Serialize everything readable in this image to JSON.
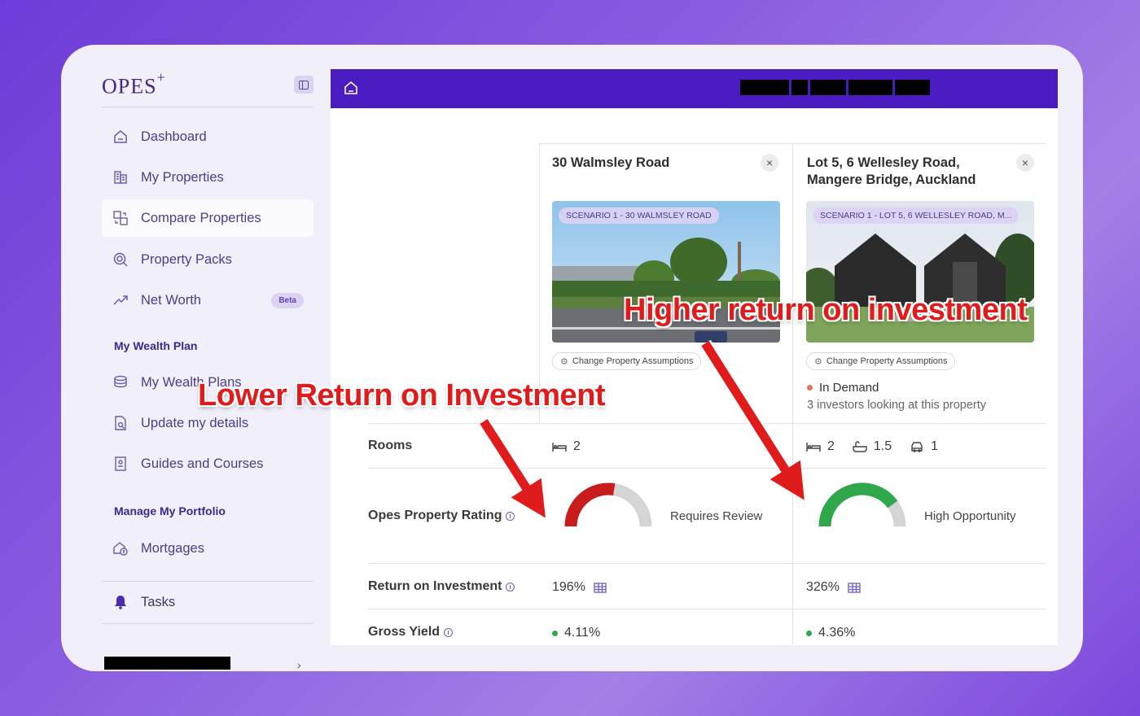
{
  "app": {
    "logo": "OPES",
    "logo_sup": "+"
  },
  "sidebar": {
    "items": [
      {
        "label": "Dashboard",
        "icon": "home-icon"
      },
      {
        "label": "My Properties",
        "icon": "buildings-icon"
      },
      {
        "label": "Compare Properties",
        "icon": "compare-icon"
      },
      {
        "label": "Property Packs",
        "icon": "search-icon"
      },
      {
        "label": "Net Worth",
        "icon": "trend-up-icon",
        "badge": "Beta"
      }
    ],
    "section_wealth": "My Wealth Plan",
    "wealth_items": [
      {
        "label": "My Wealth Plans",
        "icon": "coins-icon"
      },
      {
        "label": "Update my details",
        "icon": "document-search-icon"
      },
      {
        "label": "Guides and Courses",
        "icon": "book-icon"
      }
    ],
    "section_portfolio": "Manage My Portfolio",
    "portfolio_items": [
      {
        "label": "Mortgages",
        "icon": "house-dollar-icon"
      }
    ],
    "tasks": "Tasks"
  },
  "compare": {
    "property1": {
      "title": "30 Walmsley Road",
      "photo_label": "SCENARIO 1 - 30 WALMSLEY ROAD",
      "assumptions": "Change Property Assumptions",
      "rooms_bed": "2",
      "rating_text": "Requires Review",
      "rating_value": 0.55,
      "roi": "196%",
      "gross_yield": "4.11%"
    },
    "property2": {
      "title": "Lot 5, 6 Wellesley Road, Mangere Bridge, Auckland",
      "photo_label": "SCENARIO 1 - LOT 5, 6 WELLESLEY ROAD, M...",
      "assumptions": "Change Property Assumptions",
      "demand": "In Demand",
      "demand_sub": "3 investors looking at this property",
      "rooms_bed": "2",
      "rooms_bath": "1.5",
      "rooms_car": "1",
      "rating_text": "High Opportunity",
      "rating_value": 0.8,
      "roi": "326%",
      "gross_yield": "4.36%"
    },
    "rows": {
      "rooms": "Rooms",
      "rating": "Opes Property Rating",
      "roi": "Return on Investment",
      "gross_yield": "Gross Yield"
    }
  },
  "annotations": {
    "lower": "Lower Return on Investment",
    "higher": "Higher return on investment"
  },
  "colors": {
    "accent": "#4b1bc2",
    "red": "#c81d1d",
    "green": "#2ea84a",
    "demand_dot": "#e8735a"
  }
}
